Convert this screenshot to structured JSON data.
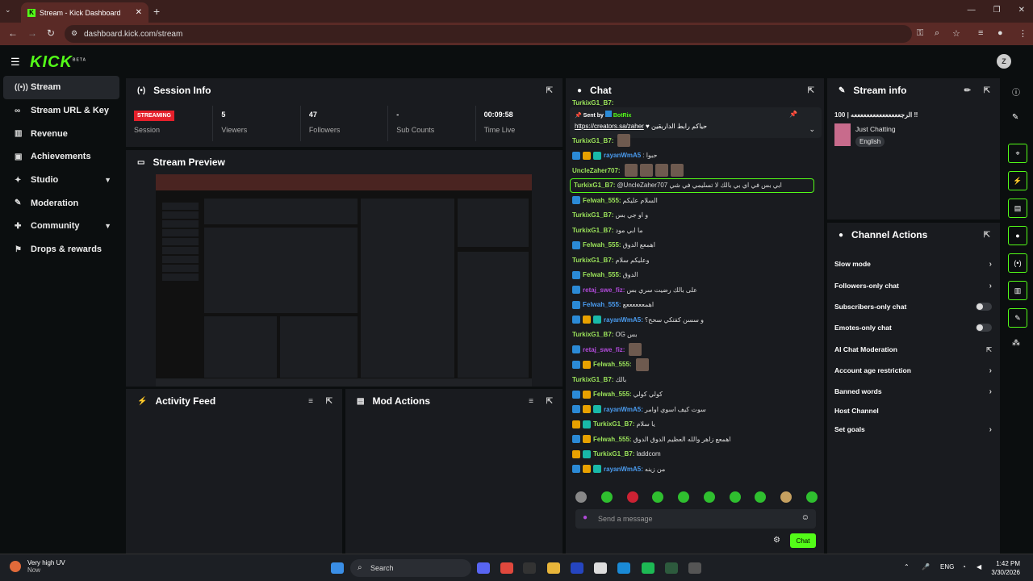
{
  "browser": {
    "tab_title": "Stream - Kick Dashboard",
    "url": "dashboard.kick.com/stream"
  },
  "header": {
    "logo": "KICK",
    "logo_sup": "BETA",
    "avatar_initial": "Z"
  },
  "sidebar": {
    "items": [
      {
        "label": "Stream",
        "icon": "stream-icon"
      },
      {
        "label": "Stream URL & Key",
        "icon": "link-icon"
      },
      {
        "label": "Revenue",
        "icon": "revenue-icon"
      },
      {
        "label": "Achievements",
        "icon": "achievements-icon"
      },
      {
        "label": "Studio",
        "icon": "studio-icon"
      },
      {
        "label": "Moderation",
        "icon": "wrench-icon"
      },
      {
        "label": "Community",
        "icon": "community-icon"
      },
      {
        "label": "Drops & rewards",
        "icon": "drops-icon"
      }
    ]
  },
  "session": {
    "title": "Session Info",
    "badge": "STREAMING",
    "session_label": "Session",
    "stats": [
      {
        "value": "5",
        "label": "Viewers"
      },
      {
        "value": "47",
        "label": "Followers"
      },
      {
        "value": "-",
        "label": "Sub Counts"
      },
      {
        "value": "00:09:58",
        "label": "Time Live"
      }
    ]
  },
  "preview": {
    "title": "Stream Preview"
  },
  "activity": {
    "title": "Activity Feed"
  },
  "mod_actions": {
    "title": "Mod Actions"
  },
  "chat": {
    "title": "Chat",
    "top_user": "TurkixG1_B7:",
    "pinned": {
      "sent_by": "Sent by",
      "bot": "BotRix",
      "link": "https://creators.sa/zaher",
      "text": "حياكم رابط الداربقين"
    },
    "messages": [
      {
        "user": "TurkixG1_B7:",
        "color": "#9be35a",
        "text": "",
        "emote": true,
        "badges": []
      },
      {
        "user": "rayanWmA5",
        "color": "#4a9cf0",
        "text": ": حبوا",
        "badges": [
          "v",
          "o",
          "t"
        ]
      },
      {
        "user": "UncleZaher707:",
        "color": "#9be35a",
        "text": "",
        "emotes": 4,
        "badges": []
      },
      {
        "user": "TurkixG1_B7:",
        "color": "#9be35a",
        "text": "@UncleZaher707 ابي بس في اي بي بالك لا تسليمي في شي",
        "highlight": true,
        "badges": []
      },
      {
        "user": "Felwah_555:",
        "color": "#9be35a",
        "text": "السلام عليكم",
        "badges": [
          "v"
        ]
      },
      {
        "user": "TurkixG1_B7:",
        "color": "#9be35a",
        "text": "و او جي بس",
        "badges": []
      },
      {
        "user": "TurkixG1_B7:",
        "color": "#9be35a",
        "text": "ما ابي مود",
        "badges": []
      },
      {
        "user": "Felwah_555:",
        "color": "#9be35a",
        "text": "اهمعع الدوق",
        "badges": [
          "v"
        ]
      },
      {
        "user": "TurkixG1_B7:",
        "color": "#9be35a",
        "text": "وعليكم سلام",
        "badges": []
      },
      {
        "user": "Felwah_555:",
        "color": "#9be35a",
        "text": "الدوق",
        "badges": [
          "v"
        ]
      },
      {
        "user": "retaj_swe_fiz:",
        "color": "#b04ad9",
        "text": "على بالك رضيت سري بس",
        "badges": [
          "v"
        ]
      },
      {
        "user": "Felwah_555:",
        "color": "#4a9cf0",
        "text": "اهمععععععع",
        "badges": [
          "v"
        ]
      },
      {
        "user": "rayanWmA5:",
        "color": "#4a9cf0",
        "text": "و سسن كفتكي سحح؟",
        "badges": [
          "v",
          "o",
          "t"
        ]
      },
      {
        "user": "TurkixG1_B7:",
        "color": "#9be35a",
        "text": "OG بس",
        "badges": []
      },
      {
        "user": "retaj_swe_fiz:",
        "color": "#b04ad9",
        "text": "",
        "emote": true,
        "badges": [
          "v"
        ]
      },
      {
        "user": "Felwah_555:",
        "color": "#9be35a",
        "text": "",
        "emote": true,
        "badges": [
          "v",
          "o"
        ]
      },
      {
        "user": "TurkixG1_B7:",
        "color": "#9be35a",
        "text": "بالك",
        "badges": []
      },
      {
        "user": "Felwah_555:",
        "color": "#9be35a",
        "text": "كولي كولي",
        "badges": [
          "v",
          "o"
        ]
      },
      {
        "user": "rayanWmA5:",
        "color": "#4a9cf0",
        "text": "سوت كيف اسوي اوامر",
        "badges": [
          "v",
          "o",
          "t"
        ]
      },
      {
        "user": "TurkixG1_B7:",
        "color": "#9be35a",
        "text": "يا سلام",
        "badges": [
          "o",
          "t"
        ]
      },
      {
        "user": "Felwah_555:",
        "color": "#9be35a",
        "text": "اهمعع زاهر والله العظيم الدوق الدوق",
        "badges": [
          "v",
          "o"
        ]
      },
      {
        "user": "TurkixG1_B7:",
        "color": "#9be35a",
        "text": "laddcom",
        "badges": [
          "o",
          "t"
        ]
      },
      {
        "user": "rayanWmA5:",
        "color": "#4a9cf0",
        "text": "من زينه",
        "badges": [
          "v",
          "o",
          "t"
        ]
      }
    ],
    "input_placeholder": "Send a message",
    "send_label": "Chat"
  },
  "stream_info": {
    "title": "Stream info",
    "stream_title": "الرجعععععععععععععععه | 100 ‼",
    "category": "Just Chatting",
    "language": "English"
  },
  "channel_actions": {
    "title": "Channel Actions",
    "items": [
      {
        "label": "Slow mode",
        "control": "arrow"
      },
      {
        "label": "Followers-only chat",
        "control": "arrow"
      },
      {
        "label": "Subscribers-only chat",
        "control": "toggle"
      },
      {
        "label": "Emotes-only chat",
        "control": "toggle"
      },
      {
        "label": "AI Chat Moderation",
        "control": "external"
      },
      {
        "label": "Account age restriction",
        "control": "arrow"
      },
      {
        "label": "Banned words",
        "control": "arrow"
      },
      {
        "label": "Host Channel",
        "control": "none"
      },
      {
        "label": "Set goals",
        "control": "arrow"
      }
    ]
  },
  "taskbar": {
    "weather_title": "Very high UV",
    "weather_sub": "Now",
    "search": "Search",
    "lang": "ENG",
    "time": "1:42 PM",
    "date": "3/30/2026"
  },
  "colors": {
    "accent": "#53fc18",
    "live": "#e5202b",
    "panel": "#191b1f",
    "bg": "#0b0e0f"
  }
}
